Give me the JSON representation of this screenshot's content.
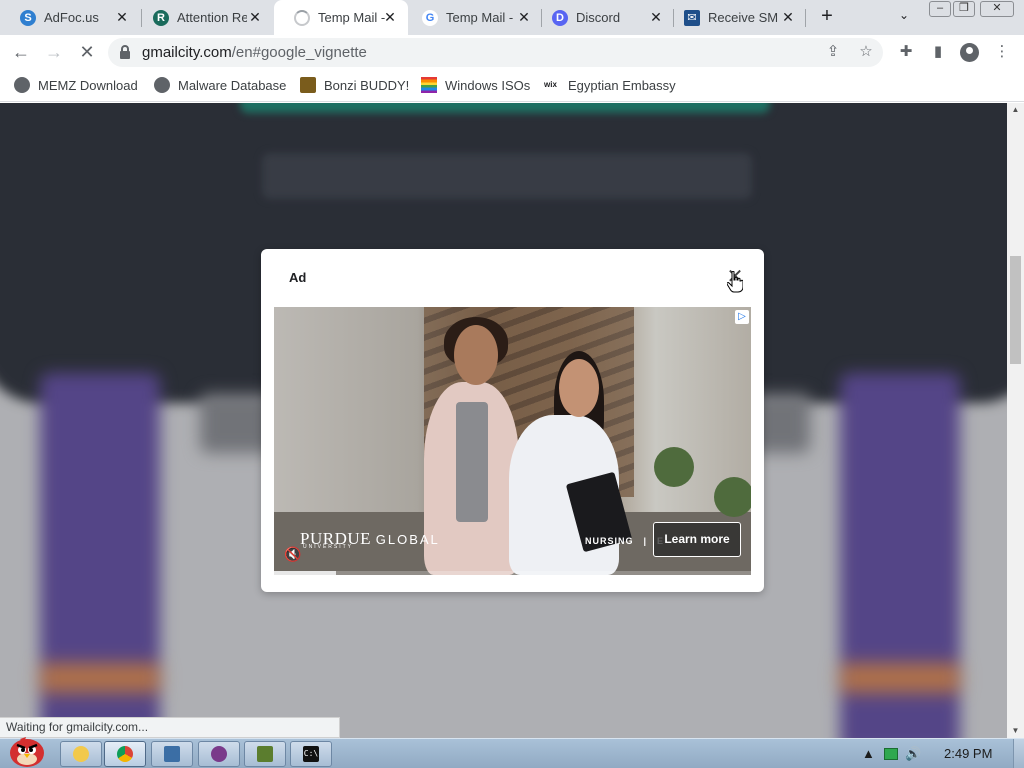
{
  "browser": {
    "tabs": [
      {
        "title": "AdFoc.us",
        "icon": "adfocus-s-icon",
        "color": "#2f7fd0",
        "active": false
      },
      {
        "title": "Attention Re",
        "icon": "attention-icon",
        "color": "#1a6b5c",
        "active": false
      },
      {
        "title": "Temp Mail -",
        "icon": "loading-spinner-icon",
        "color": "#9aa0a6",
        "active": true
      },
      {
        "title": "Temp Mail -",
        "icon": "google-g-icon",
        "color": "#4285f4",
        "active": false
      },
      {
        "title": "Discord",
        "icon": "discord-icon",
        "color": "#5865f2",
        "active": false
      },
      {
        "title": "Receive SM",
        "icon": "receive-sms-icon",
        "color": "#1f4f8a",
        "active": false
      }
    ],
    "new_tab_label": "+",
    "tab_search_glyph": "⌄",
    "window_controls": {
      "minimize": "–",
      "restore": "❐",
      "close": "✕"
    },
    "address": {
      "domain": "gmailcity.com",
      "path": "/en#google_vignette"
    },
    "bookmarks": [
      {
        "label": "MEMZ Download",
        "icon": "globe-icon",
        "color": "#5f6368"
      },
      {
        "label": "Malware Database",
        "icon": "globe-icon",
        "color": "#5f6368"
      },
      {
        "label": "Bonzi BUDDY!",
        "icon": "bonzi-trophy-icon",
        "color": "#7a5c1c"
      },
      {
        "label": "Windows ISOs",
        "icon": "rainbow-flag-icon",
        "color": "#e04040"
      },
      {
        "label": "Egyptian Embassy",
        "icon": "wix-icon",
        "color": "#202124"
      }
    ]
  },
  "ad": {
    "label": "Ad",
    "close_glyph": "✕",
    "ad_choices_glyph": "▷",
    "brand": "PURDUE",
    "brand_global": "GLOBAL",
    "brand_sub": "UNIVERSITY",
    "program": "NURSING",
    "program_sep": "|",
    "program_more": "E",
    "mute_glyph": "🔇",
    "cta": "Learn more",
    "progress": 0.13
  },
  "status_text": "Waiting for gmailcity.com...",
  "taskbar": {
    "clock": "2:49 PM",
    "items": [
      {
        "name": "explorer",
        "color": "#f2c94c"
      },
      {
        "name": "chrome",
        "color": "#db4437"
      },
      {
        "name": "app-window",
        "color": "#3b6ea5"
      },
      {
        "name": "bug-app",
        "color": "#7a3a8a"
      },
      {
        "name": "minecraft",
        "color": "#5b7d2e"
      },
      {
        "name": "cmd",
        "color": "#111111"
      }
    ]
  },
  "colors": {
    "accent": "#1a73e8",
    "page_bg_dark": "#2c3038",
    "side_purple": "#5b4a92"
  }
}
